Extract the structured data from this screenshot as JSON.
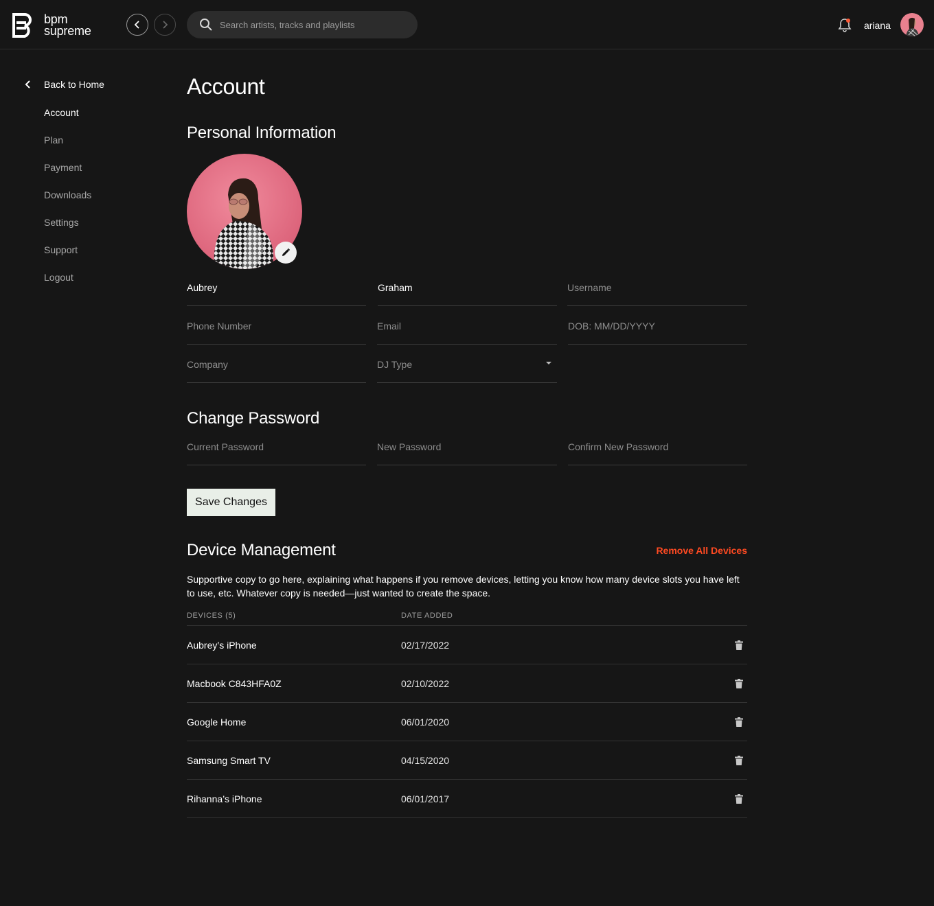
{
  "brand": {
    "line1": "bpm",
    "line2": "supreme"
  },
  "header": {
    "search_placeholder": "Search artists, tracks and playlists",
    "username": "ariana",
    "accent_color": "#ff5a36"
  },
  "sidebar": {
    "back_label": "Back to Home",
    "items": [
      {
        "label": "Account",
        "active": true
      },
      {
        "label": "Plan",
        "active": false
      },
      {
        "label": "Payment",
        "active": false
      },
      {
        "label": "Downloads",
        "active": false
      },
      {
        "label": "Settings",
        "active": false
      },
      {
        "label": "Support",
        "active": false
      },
      {
        "label": "Logout",
        "active": false
      }
    ]
  },
  "page": {
    "title": "Account"
  },
  "personal": {
    "heading": "Personal Information",
    "first_name": "Aubrey",
    "last_name": "Graham",
    "username_placeholder": "Username",
    "phone_placeholder": "Phone Number",
    "email_placeholder": "Email",
    "dob_placeholder": "DOB: MM/DD/YYYY",
    "company_placeholder": "Company",
    "dj_type_placeholder": "DJ Type"
  },
  "password": {
    "heading": "Change Password",
    "current_placeholder": "Current Password",
    "new_placeholder": "New Password",
    "confirm_placeholder": "Confirm New Password"
  },
  "save_label": "Save Changes",
  "devices": {
    "heading": "Device Management",
    "remove_all_label": "Remove All Devices",
    "remove_color": "#ff4a22",
    "description": "Supportive copy to go here, explaining what happens if you remove devices, letting you know how many device slots you have left to use, etc. Whatever copy is needed—just wanted to create the space.",
    "col_devices": "DEVICES (5)",
    "col_date": "DATE ADDED",
    "rows": [
      {
        "name": "Aubrey’s iPhone",
        "date": "02/17/2022"
      },
      {
        "name": "Macbook C843HFA0Z",
        "date": "02/10/2022"
      },
      {
        "name": "Google Home",
        "date": "06/01/2020"
      },
      {
        "name": "Samsung Smart TV",
        "date": "04/15/2020"
      },
      {
        "name": "Rihanna’s iPhone",
        "date": "06/01/2017"
      }
    ]
  }
}
